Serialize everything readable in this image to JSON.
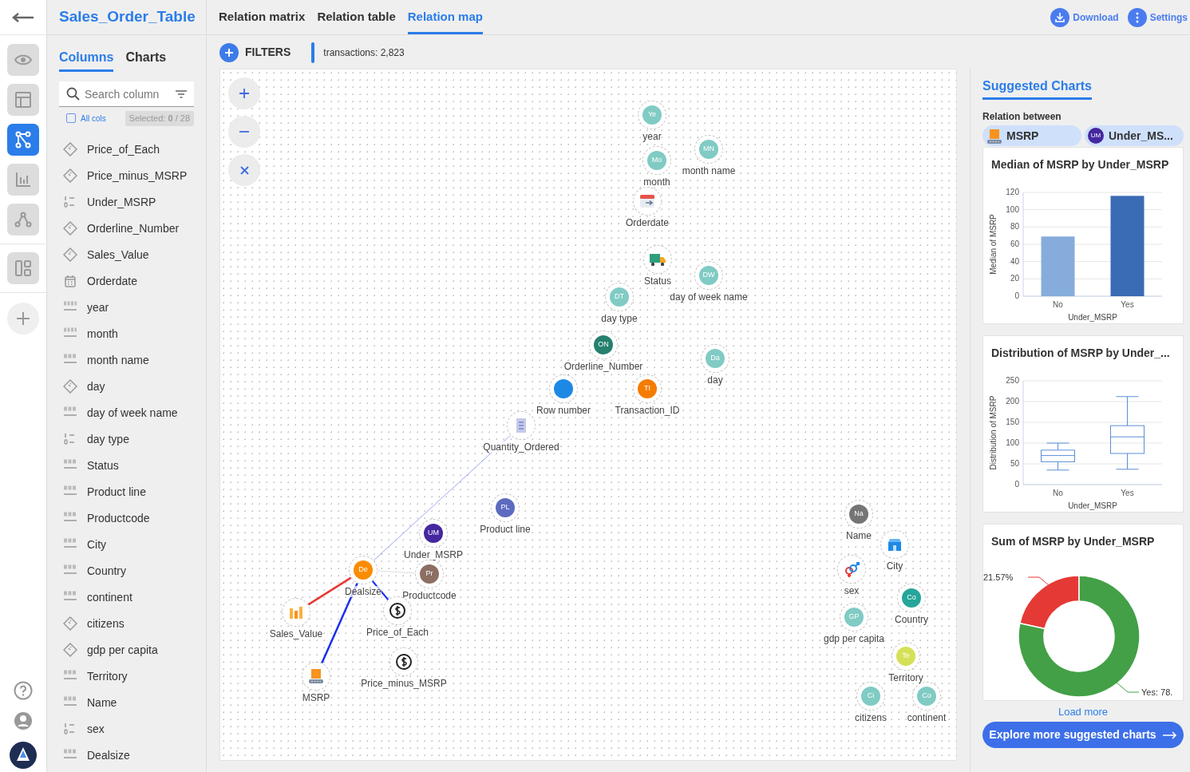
{
  "app": {
    "title": "Sales_Order_Table"
  },
  "rail": {
    "items": [
      {
        "kind": "eye",
        "selected": false
      },
      {
        "kind": "layout",
        "selected": false
      },
      {
        "kind": "graph",
        "selected": true
      },
      {
        "kind": "bars",
        "selected": false
      },
      {
        "kind": "network",
        "selected": false
      },
      {
        "kind": "dashboard",
        "selected": false
      }
    ]
  },
  "sidebar": {
    "tabs": [
      {
        "label": "Columns",
        "selected": true
      },
      {
        "label": "Charts",
        "selected": false
      }
    ],
    "search": {
      "placeholder": "Search column"
    },
    "all_cols": {
      "label": "All cols",
      "checked": false
    },
    "selected_count": "Selected: **0** / 28",
    "columns": [
      {
        "name": "Price_of_Each",
        "kind": "measure"
      },
      {
        "name": "Price_minus_MSRP",
        "kind": "measure"
      },
      {
        "name": "Under_MSRP",
        "kind": "binary"
      },
      {
        "name": "Orderline_Number",
        "kind": "measure"
      },
      {
        "name": "Sales_Value",
        "kind": "measure"
      },
      {
        "name": "Orderdate",
        "kind": "date"
      },
      {
        "name": "year",
        "kind": "number"
      },
      {
        "name": "month",
        "kind": "number"
      },
      {
        "name": "month name",
        "kind": "text"
      },
      {
        "name": "day",
        "kind": "measure"
      },
      {
        "name": "day of week name",
        "kind": "text"
      },
      {
        "name": "day type",
        "kind": "binary"
      },
      {
        "name": "Status",
        "kind": "text"
      },
      {
        "name": "Product line",
        "kind": "text"
      },
      {
        "name": "Productcode",
        "kind": "text"
      },
      {
        "name": "City",
        "kind": "text"
      },
      {
        "name": "Country",
        "kind": "text"
      },
      {
        "name": "continent",
        "kind": "text"
      },
      {
        "name": "citizens",
        "kind": "measure"
      },
      {
        "name": "gdp per capita",
        "kind": "measure"
      },
      {
        "name": "Territory",
        "kind": "text"
      },
      {
        "name": "Name",
        "kind": "text"
      },
      {
        "name": "sex",
        "kind": "binary"
      },
      {
        "name": "Dealsize",
        "kind": "text"
      }
    ]
  },
  "tabs": [
    {
      "label": "Relation matrix",
      "selected": false
    },
    {
      "label": "Relation table",
      "selected": false
    },
    {
      "label": "Relation map",
      "selected": true
    }
  ],
  "actions": [
    {
      "label": "Download",
      "kind": "download"
    },
    {
      "label": "Settings",
      "kind": "more"
    }
  ],
  "filters": {
    "label": "FILTERS",
    "summary": "transactions: 2,823"
  },
  "map": {
    "nodes": [
      {
        "label": "year",
        "kind": "initials",
        "badge": "Ye",
        "color": "#80cbc4"
      },
      {
        "label": "month name",
        "kind": "initials",
        "badge": "MN",
        "color": "#80cbc4"
      },
      {
        "label": "month",
        "kind": "initials",
        "badge": "Mo",
        "color": "#80cbc4"
      },
      {
        "label": "Orderdate",
        "kind": "calendar"
      },
      {
        "label": "Status",
        "kind": "truck"
      },
      {
        "label": "day of week name",
        "kind": "initials",
        "badge": "DW",
        "color": "#80cbc4"
      },
      {
        "label": "day type",
        "kind": "initials",
        "badge": "DT",
        "color": "#80cbc4"
      },
      {
        "label": "Orderline_Number",
        "kind": "initials",
        "badge": "ON",
        "color": "#26806e"
      },
      {
        "label": "Row number",
        "kind": "dot",
        "color": "#1e88e5"
      },
      {
        "label": "Transaction_ID",
        "kind": "initials",
        "badge": "TI",
        "color": "#f57c00"
      },
      {
        "label": "day",
        "kind": "initials",
        "badge": "Da",
        "color": "#80cbc4"
      },
      {
        "label": "Quantity_Ordered",
        "kind": "sheet"
      },
      {
        "label": "Product line",
        "kind": "initials",
        "badge": "PL",
        "color": "#5c6bc0"
      },
      {
        "label": "Under_MSRP",
        "kind": "initials",
        "badge": "UM",
        "color": "#4527a0"
      },
      {
        "label": "Productcode",
        "kind": "initials",
        "badge": "Pr",
        "color": "#8d6e63"
      },
      {
        "label": "Dealsize",
        "kind": "initials",
        "badge": "De",
        "color": "#fb8c00"
      },
      {
        "label": "Sales_Value",
        "kind": "bars"
      },
      {
        "label": "Price_of_Each",
        "kind": "coin"
      },
      {
        "label": "Price_minus_MSRP",
        "kind": "coin"
      },
      {
        "label": "MSRP",
        "kind": "machine"
      },
      {
        "label": "Name",
        "kind": "initials",
        "badge": "Na",
        "color": "#757575"
      },
      {
        "label": "City",
        "kind": "shop"
      },
      {
        "label": "sex",
        "kind": "gender"
      },
      {
        "label": "gdp per capita",
        "kind": "initials",
        "badge": "GP",
        "color": "#80cbc4"
      },
      {
        "label": "Country",
        "kind": "initials",
        "badge": "Co",
        "color": "#26a69a"
      },
      {
        "label": "Territory",
        "kind": "initials",
        "badge": "Te",
        "color": "#d4e157"
      },
      {
        "label": "citizens",
        "kind": "initials",
        "badge": "Ci",
        "color": "#80cbc4"
      },
      {
        "label": "continent",
        "kind": "initials",
        "badge": "Co",
        "color": "#80cbc4"
      }
    ],
    "edges": [
      {
        "kind": "faint"
      },
      {
        "kind": "grey"
      },
      {
        "kind": "strong"
      },
      {
        "kind": "negative"
      },
      {
        "kind": "positive"
      }
    ]
  },
  "suggested": {
    "title": "Suggested Charts",
    "relation_label": "Relation between",
    "chips": [
      {
        "label": "MSRP",
        "kind": "machine"
      },
      {
        "label": "Under_MS...",
        "kind": "initials",
        "badge": "UM",
        "color": "#4527a0"
      }
    ],
    "cards": [
      {
        "title": "Median of MSRP by Under_MSRP",
        "chart_data": {
          "type": "bar",
          "xlabel": "Under_MSRP",
          "ylabel": "Median of MSRP",
          "categories": [
            "No",
            "Yes"
          ],
          "values": [
            69,
            116
          ],
          "colors": [
            "#86acdb",
            "#3a6bb5"
          ],
          "grid": true,
          "ylim": [
            0,
            120
          ],
          "yticks": [
            0,
            20,
            40,
            60,
            80,
            100,
            120
          ]
        }
      },
      {
        "title": "Distribution of MSRP by Under_...",
        "box_plot": {
          "kind": "picture",
          "xlabel": "Under_MSRP",
          "ylabel": "Distribution of MSRP",
          "categories": [
            "No",
            "Yes"
          ],
          "yticks": [
            "250",
            "200",
            "150",
            "100",
            "50",
            "0"
          ]
        }
      },
      {
        "title": "Sum of MSRP by Under_MSRP",
        "chart_data": {
          "type": "donut",
          "values": [
            21.57,
            78.43
          ],
          "colors": [
            "#e53935",
            "#43a047"
          ],
          "value_labels": [
            "21.57%",
            "Yes: 78."
          ]
        }
      }
    ],
    "load_more": "Load more",
    "explore": "Explore more suggested charts"
  }
}
